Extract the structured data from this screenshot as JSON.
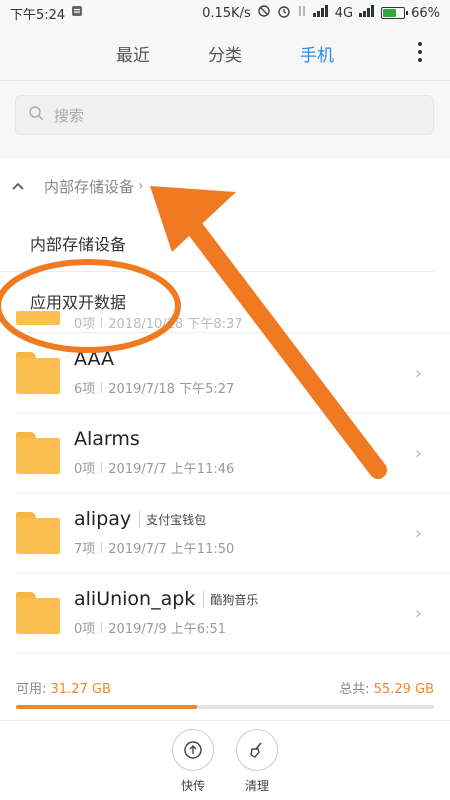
{
  "status_bar": {
    "time": "下午5:24",
    "net_speed": "0.15K/s",
    "network": "4G",
    "battery": "66%",
    "battery_level": 0.66
  },
  "tabs": [
    {
      "label": "最近",
      "active": false
    },
    {
      "label": "分类",
      "active": false
    },
    {
      "label": "手机",
      "active": true
    }
  ],
  "search": {
    "placeholder": "搜索"
  },
  "breadcrumb": {
    "label": "内部存储设备"
  },
  "dropdown": [
    {
      "label": "内部存储设备"
    },
    {
      "label": "应用双开数据"
    }
  ],
  "files": [
    {
      "name": "",
      "tag": "",
      "count": "0项",
      "date": "2018/10/18 下午8:37",
      "partial": true
    },
    {
      "name": "AAA",
      "tag": "",
      "count": "6项",
      "date": "2019/7/18 下午5:27"
    },
    {
      "name": "Alarms",
      "tag": "",
      "count": "0项",
      "date": "2019/7/7 上午11:46"
    },
    {
      "name": "alipay",
      "tag": "支付宝钱包",
      "count": "7项",
      "date": "2019/7/7 上午11:50"
    },
    {
      "name": "aliUnion_apk",
      "tag": "酷狗音乐",
      "count": "0项",
      "date": "2019/7/9 上午6:51"
    }
  ],
  "storage": {
    "available_label": "可用: ",
    "available": "31.27 GB",
    "total_label": "总共: ",
    "total": "55.29 GB",
    "used_fraction": 0.434
  },
  "actions": [
    {
      "label": "快传",
      "icon": "upload-icon"
    },
    {
      "label": "清理",
      "icon": "broom-icon"
    }
  ],
  "colors": {
    "accent": "#2a8cf0",
    "annotation": "#f07a22",
    "folder": "#fbc04f"
  }
}
